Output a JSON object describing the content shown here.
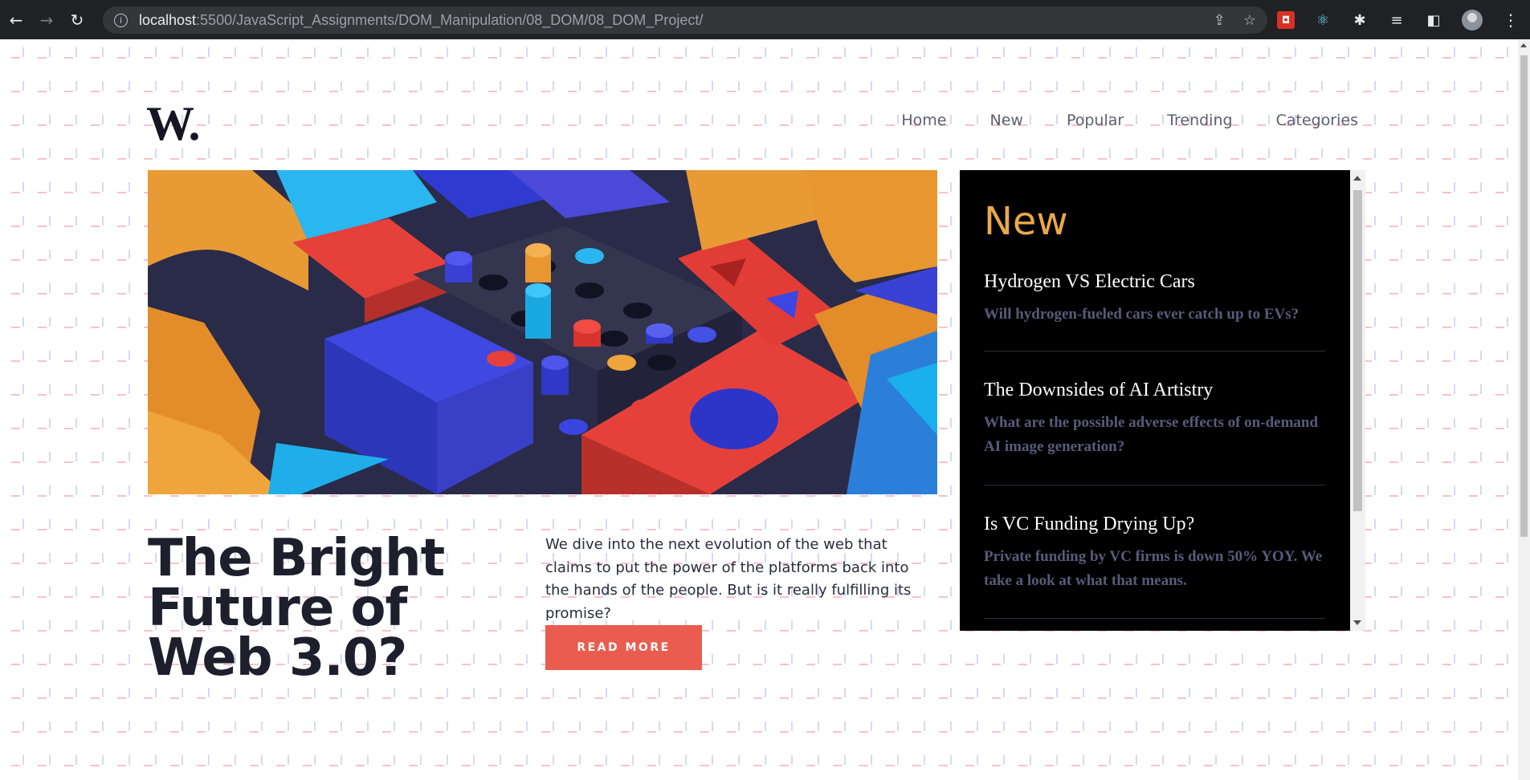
{
  "browser": {
    "url_host": "localhost",
    "url_rest": ":5500/JavaScript_Assignments/DOM_Manipulation/08_DOM/08_DOM_Project/"
  },
  "site": {
    "logo": "W.",
    "nav": [
      "Home",
      "New",
      "Popular",
      "Trending",
      "Categories"
    ]
  },
  "hero": {
    "headline": "The Bright Future of Web 3.0?",
    "teaser": "We dive into the next evolution of the web that claims to put the power of the platforms back into the hands of the people. But is it really fulfilling its promise?",
    "cta": "READ MORE"
  },
  "new_panel": {
    "title": "New",
    "items": [
      {
        "title": "Hydrogen VS Electric Cars",
        "desc": "Will hydrogen-fueled cars ever catch up to EVs?"
      },
      {
        "title": "The Downsides of AI Artistry",
        "desc": "What are the possible adverse effects of on-demand AI image generation?"
      },
      {
        "title": "Is VC Funding Drying Up?",
        "desc": "Private funding by VC firms is down 50% YOY. We take a look at what that means."
      }
    ]
  },
  "colors": {
    "accent_orange": "#e9a84c",
    "cta_red": "#ea5c4f",
    "headline_dark": "#1d1f2c"
  }
}
